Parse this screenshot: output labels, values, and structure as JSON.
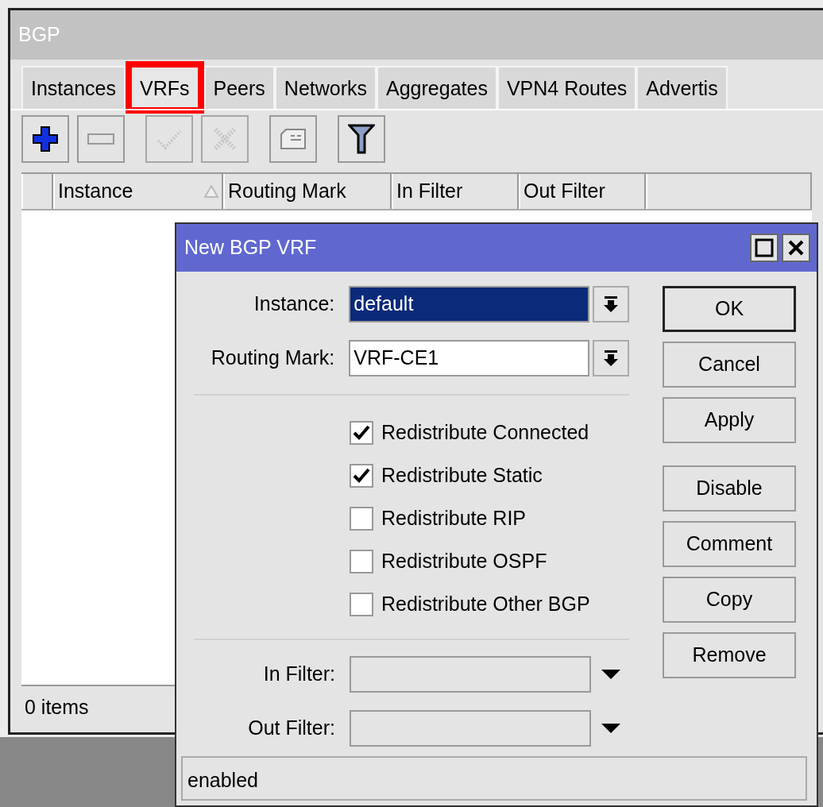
{
  "window": {
    "title": "BGP"
  },
  "tabs": [
    {
      "label": "Instances",
      "selected": false,
      "highlighted": false
    },
    {
      "label": "VRFs",
      "selected": true,
      "highlighted": true
    },
    {
      "label": "Peers",
      "selected": false,
      "highlighted": false
    },
    {
      "label": "Networks",
      "selected": false,
      "highlighted": false
    },
    {
      "label": "Aggregates",
      "selected": false,
      "highlighted": false
    },
    {
      "label": "VPN4 Routes",
      "selected": false,
      "highlighted": false
    },
    {
      "label": "Advertis",
      "selected": false,
      "highlighted": false
    }
  ],
  "toolbar": [
    {
      "kind": "add",
      "disabled": false
    },
    {
      "kind": "remove",
      "disabled": false
    },
    {
      "kind": "enable",
      "disabled": true
    },
    {
      "kind": "disable",
      "disabled": true
    },
    {
      "kind": "comment",
      "disabled": false
    },
    {
      "kind": "filter",
      "disabled": false
    }
  ],
  "table": {
    "columns": [
      {
        "label": "Instance",
        "sorted": true
      },
      {
        "label": "Routing Mark",
        "sorted": false
      },
      {
        "label": "In Filter",
        "sorted": false
      },
      {
        "label": "Out Filter",
        "sorted": false
      }
    ]
  },
  "status_bar": "0 items",
  "dialog": {
    "title": "New BGP VRF",
    "fields": [
      {
        "label": "Instance:",
        "value": "default",
        "selected": true,
        "kind": "combo"
      },
      {
        "label": "Routing Mark:",
        "value": "VRF-CE1",
        "selected": false,
        "kind": "combo"
      }
    ],
    "checkboxes": [
      {
        "label": "Redistribute Connected",
        "checked": true
      },
      {
        "label": "Redistribute Static",
        "checked": true
      },
      {
        "label": "Redistribute RIP",
        "checked": false
      },
      {
        "label": "Redistribute OSPF",
        "checked": false
      },
      {
        "label": "Redistribute Other BGP",
        "checked": false
      }
    ],
    "filters": [
      {
        "label": "In Filter:",
        "kind": "dropdown"
      },
      {
        "label": "Out Filter:",
        "kind": "dropdown"
      }
    ],
    "buttons": [
      {
        "label": "OK",
        "default": true
      },
      {
        "label": "Cancel",
        "default": false
      },
      {
        "label": "Apply",
        "default": false
      },
      {
        "label": "Disable",
        "default": false
      },
      {
        "label": "Comment",
        "default": false
      },
      {
        "label": "Copy",
        "default": false
      },
      {
        "label": "Remove",
        "default": false
      }
    ],
    "status": "enabled"
  }
}
